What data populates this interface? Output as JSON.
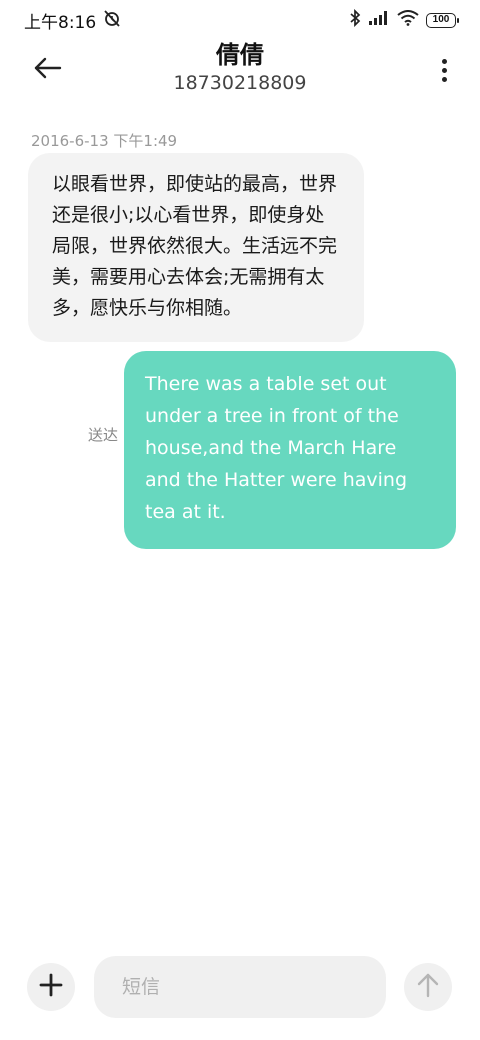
{
  "status_bar": {
    "time": "上午8:16",
    "battery": "100",
    "icons": [
      "alarm-off-icon",
      "bluetooth-icon",
      "signal-icon",
      "wifi-icon",
      "battery-icon"
    ]
  },
  "header": {
    "contact_name": "倩倩",
    "contact_number": "18730218809",
    "icons": [
      "back-arrow-icon",
      "more-vertical-icon"
    ]
  },
  "conversation": {
    "timestamp": "2016-6-13 下午1:49",
    "messages": [
      {
        "direction": "incoming",
        "text": "以眼看世界，即使站的最高，世界还是很小;以心看世界，即使身处局限，世界依然很大。生活远不完美，需要用心去体会;无需拥有太多，愿快乐与你相随。"
      },
      {
        "direction": "outgoing",
        "text": "There was a table set out under a tree in front of the house,and the March Hare and the Hatter were having tea at it.",
        "status": "送达"
      }
    ]
  },
  "composer": {
    "placeholder": "短信",
    "value": "",
    "icons": [
      "plus-icon",
      "send-arrow-up-icon"
    ]
  },
  "colors": {
    "outgoing_bubble": "#67d8bf",
    "incoming_bubble": "#f3f3f3",
    "background": "#ffffff"
  }
}
